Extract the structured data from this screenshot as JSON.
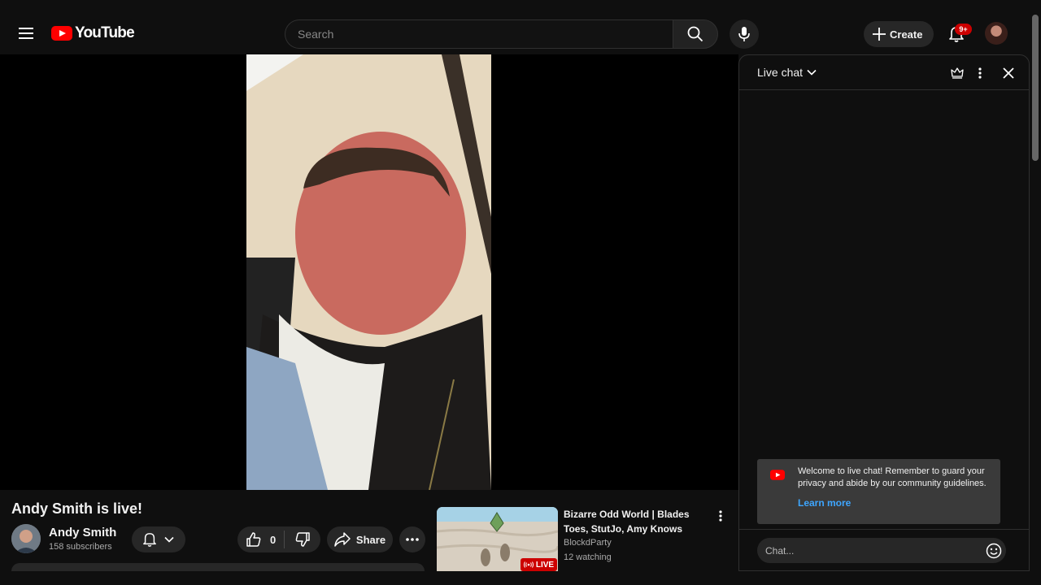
{
  "header": {
    "logo_text": "YouTube",
    "search_placeholder": "Search",
    "create_label": "Create",
    "notifications_badge": "9+"
  },
  "video": {
    "title": "Andy Smith is live!",
    "channel_name": "Andy Smith",
    "subscribers": "158 subscribers",
    "like_count": "0",
    "share_label": "Share"
  },
  "recommendation": {
    "title": "Bizarre Odd World | Blades Toes, StutJo, Amy Knows",
    "channel": "BlockdParty",
    "watching": "12 watching",
    "badge": "LIVE"
  },
  "chat": {
    "title": "Live chat",
    "welcome_text": "Welcome to live chat! Remember to guard your privacy and abide by our community guidelines.",
    "learn_more": "Learn more",
    "input_placeholder": "Chat..."
  },
  "colors": {
    "background": "#0f0f0f",
    "brand_red": "#ff0000",
    "live_red": "#cc0000",
    "link_blue": "#3ea6ff",
    "pill_bg": "#272727"
  },
  "icons": [
    "menu-icon",
    "youtube-logo-icon",
    "search-icon",
    "mic-icon",
    "plus-icon",
    "bell-icon",
    "chevron-down-icon",
    "thumbs-up-icon",
    "thumbs-down-icon",
    "share-icon",
    "more-horizontal-icon",
    "more-vertical-icon",
    "crown-icon",
    "close-icon",
    "emoji-icon",
    "live-broadcast-icon"
  ]
}
